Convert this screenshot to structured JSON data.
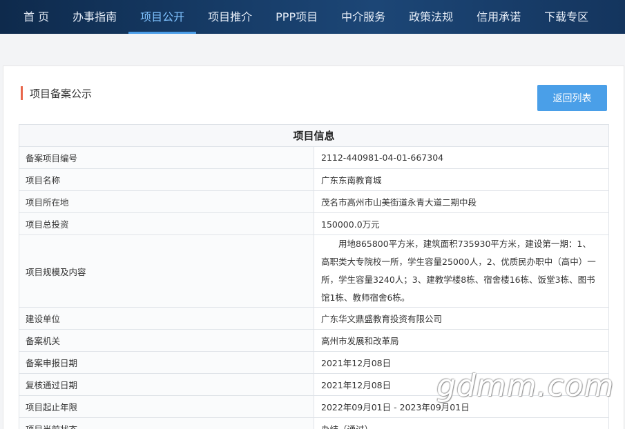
{
  "nav": {
    "items": [
      {
        "label": "首 页"
      },
      {
        "label": "办事指南"
      },
      {
        "label": "项目公开",
        "active": true
      },
      {
        "label": "项目推介"
      },
      {
        "label": "PPP项目"
      },
      {
        "label": "中介服务"
      },
      {
        "label": "政策法规"
      },
      {
        "label": "信用承诺"
      },
      {
        "label": "下载专区"
      }
    ]
  },
  "section": {
    "title": "项目备案公示",
    "back_label": "返回列表"
  },
  "table": {
    "header": "项目信息",
    "rows": [
      {
        "label": "备案项目编号",
        "value": "2112-440981-04-01-667304"
      },
      {
        "label": "项目名称",
        "value": "广东东南教育城"
      },
      {
        "label": "项目所在地",
        "value": "茂名市高州市山美街道永青大道二期中段"
      },
      {
        "label": "项目总投资",
        "value": "150000.0万元"
      },
      {
        "label": "项目规模及内容",
        "value": "用地865800平方米，建筑面积735930平方米，建设第一期：1、高职类大专院校一所，学生容量25000人，2、优质民办职中（高中）一所，学生容量3240人；3、建教学楼8栋、宿舍楼16栋、饭堂3栋、图书馆1栋、教师宿舍6栋。"
      },
      {
        "label": "建设单位",
        "value": "广东华文鼎盛教育投资有限公司"
      },
      {
        "label": "备案机关",
        "value": "高州市发展和改革局"
      },
      {
        "label": "备案申报日期",
        "value": "2021年12月08日"
      },
      {
        "label": "复核通过日期",
        "value": "2021年12月08日"
      },
      {
        "label": "项目起止年限",
        "value": "2022年09月01日 - 2023年09月01日"
      },
      {
        "label": "项目当前状态",
        "value": "办结（通过）"
      }
    ]
  },
  "watermark": "gdmm.com",
  "colors": {
    "nav_bg": "#163b66",
    "nav_active": "#7fc2ff",
    "accent_bar": "#e8664b",
    "button": "#4a9fe8"
  }
}
